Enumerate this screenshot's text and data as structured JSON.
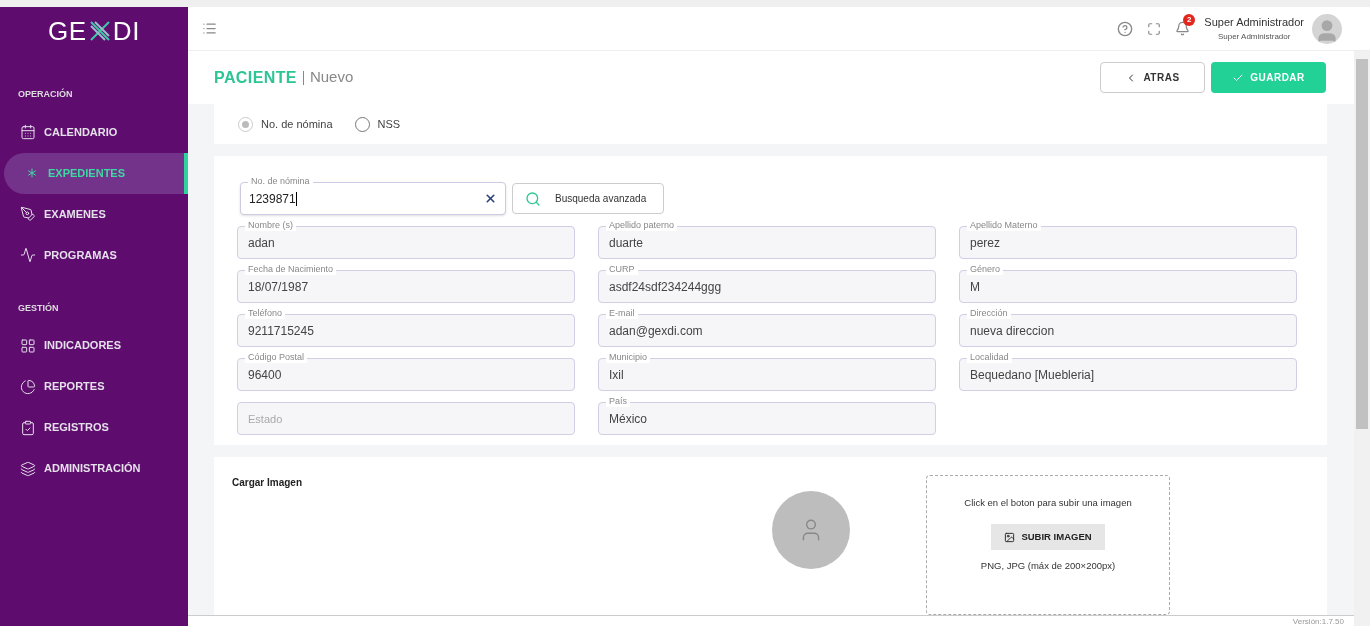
{
  "logo": {
    "text_left": "GE",
    "text_right": "DI"
  },
  "sidebar": {
    "sections": [
      {
        "title": "OPERACIÓN",
        "items": [
          {
            "label": "CALENDARIO",
            "selected": false
          },
          {
            "label": "EXPEDIENTES",
            "selected": true
          },
          {
            "label": "EXAMENES",
            "selected": false
          },
          {
            "label": "PROGRAMAS",
            "selected": false
          }
        ]
      },
      {
        "title": "GESTIÓN",
        "items": [
          {
            "label": "INDICADORES",
            "selected": false
          },
          {
            "label": "REPORTES",
            "selected": false
          },
          {
            "label": "REGISTROS",
            "selected": false
          },
          {
            "label": "ADMINISTRACIÓN",
            "selected": false
          }
        ]
      }
    ]
  },
  "header": {
    "notification_count": "2",
    "user_name": "Super Administrador",
    "user_role": "Super Administrador"
  },
  "page": {
    "title": "PACIENTE",
    "subtitle": "Nuevo",
    "back_button": "ATRAS",
    "save_button": "GUARDAR"
  },
  "id_type": [
    {
      "label": "No. de nómina",
      "selected": true
    },
    {
      "label": "NSS",
      "selected": false
    }
  ],
  "search": {
    "label": "No. de nómina",
    "value": "1239871",
    "advanced_button": "Busqueda avanzada"
  },
  "field_rows": [
    [
      {
        "label": "Nombre (s)",
        "value": "adan"
      },
      {
        "label": "Apellido paterno",
        "value": "duarte"
      },
      {
        "label": "Apellido Materno",
        "value": "perez"
      }
    ],
    [
      {
        "label": "Fecha de Nacimiento",
        "value": "18/07/1987"
      },
      {
        "label": "CURP",
        "value": "asdf24sdf234244ggg"
      },
      {
        "label": "Género",
        "value": "M"
      }
    ],
    [
      {
        "label": "Teléfono",
        "value": "9211715245"
      },
      {
        "label": "E-mail",
        "value": "adan@gexdi.com"
      },
      {
        "label": "Dirección",
        "value": "nueva direccion"
      }
    ],
    [
      {
        "label": "Código Postal",
        "value": "96400"
      },
      {
        "label": "Municipio",
        "value": "Ixil"
      },
      {
        "label": "Localidad",
        "value": "Bequedano [Muebleria]"
      }
    ],
    [
      {
        "placeholder": "Estado"
      },
      {
        "label": "País",
        "value": "México"
      }
    ]
  ],
  "image_upload": {
    "title": "Cargar Imagen",
    "hint": "Click en el boton para subir una imagen",
    "button": "SUBIR IMAGEN",
    "formats": "PNG, JPG (máx de 200×200px)"
  },
  "footer": {
    "version": "Versión:1.7.50"
  }
}
